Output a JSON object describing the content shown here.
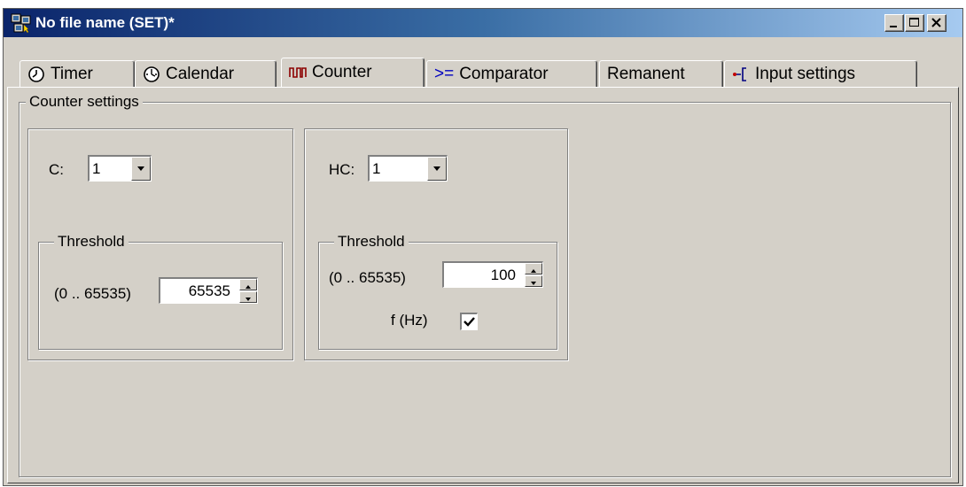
{
  "window": {
    "title": "No file name (SET)*"
  },
  "tabs": [
    {
      "label": "Timer",
      "icon": "clock-icon"
    },
    {
      "label": "Calendar",
      "icon": "calendar-clock-icon"
    },
    {
      "label": "Counter",
      "icon": "pulse-counter-icon",
      "active": true
    },
    {
      "label": "Comparator",
      "icon": "greater-equal-icon",
      "glyph": ">="
    },
    {
      "label": "Remanent"
    },
    {
      "label": "Input settings",
      "icon": "input-branch-icon"
    }
  ],
  "counter_settings": {
    "group_label": "Counter settings",
    "counter": {
      "select_label": "C:",
      "select_value": "1",
      "threshold_label": "Threshold",
      "range_label": "(0 .. 65535)",
      "threshold_value": "65535"
    },
    "high_speed_counter": {
      "select_label": "HC:",
      "select_value": "1",
      "threshold_label": "Threshold",
      "range_label": "(0 .. 65535)",
      "threshold_value": "100",
      "frequency_label": "f (Hz)",
      "frequency_checked": true
    }
  },
  "colors": {
    "face": "#d4d0c8",
    "title_start": "#0a246a",
    "title_end": "#a6caf0"
  }
}
